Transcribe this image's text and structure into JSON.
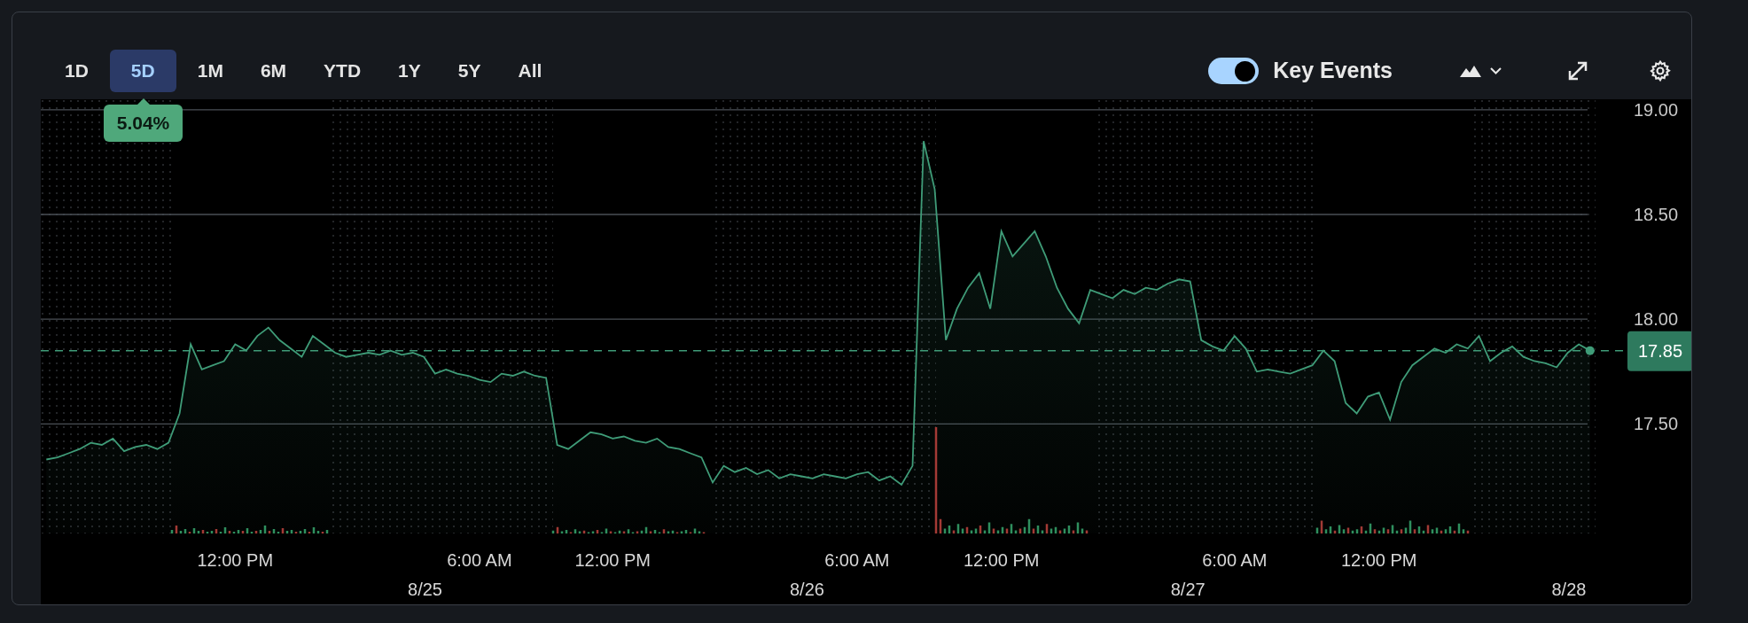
{
  "range_tabs": [
    {
      "label": "1D",
      "selected": false
    },
    {
      "label": "5D",
      "selected": true
    },
    {
      "label": "1M",
      "selected": false
    },
    {
      "label": "6M",
      "selected": false
    },
    {
      "label": "YTD",
      "selected": false
    },
    {
      "label": "1Y",
      "selected": false
    },
    {
      "label": "5Y",
      "selected": false
    },
    {
      "label": "All",
      "selected": false
    }
  ],
  "change_badge": "5.04%",
  "key_events": {
    "label": "Key Events",
    "on": true
  },
  "chart": {
    "current_price": "17.85",
    "date_labels": [
      "8/25",
      "8/26",
      "8/27",
      "8/28"
    ],
    "chart_data": {
      "type": "area",
      "grid": true,
      "categories": [
        null,
        null,
        null,
        null,
        null,
        null,
        null,
        null,
        null,
        null,
        null,
        null,
        null,
        null,
        null,
        null,
        null,
        "12:00 PM",
        null,
        null,
        null,
        null,
        null,
        null,
        null,
        null,
        null,
        null,
        null,
        null,
        null,
        null,
        null,
        null,
        null,
        null,
        null,
        null,
        null,
        "6:00 AM",
        null,
        null,
        null,
        null,
        null,
        null,
        null,
        null,
        null,
        null,
        null,
        "12:00 PM",
        null,
        null,
        null,
        null,
        null,
        null,
        null,
        null,
        null,
        null,
        null,
        null,
        null,
        null,
        null,
        null,
        null,
        null,
        null,
        null,
        null,
        "6:00 AM",
        null,
        null,
        null,
        null,
        null,
        null,
        null,
        null,
        null,
        null,
        null,
        null,
        "12:00 PM",
        null,
        null,
        null,
        null,
        null,
        null,
        null,
        null,
        null,
        null,
        null,
        null,
        null,
        null,
        null,
        null,
        null,
        null,
        null,
        null,
        "6:00 AM",
        null,
        null,
        null,
        null,
        null,
        null,
        null,
        null,
        null,
        null,
        null,
        null,
        "12:00 PM",
        null,
        null,
        null,
        null,
        null,
        null,
        null,
        null,
        null,
        null,
        null,
        null,
        null,
        null,
        null,
        null,
        null,
        null,
        null
      ],
      "ylim": [
        16.63,
        19.05
      ],
      "ref_lines": [
        {
          "value": 17.85,
          "axis": "y"
        }
      ],
      "yticks": [
        {
          "value": 17.5,
          "label": "17.50"
        },
        {
          "value": 18,
          "label": "18.00"
        },
        {
          "value": 18.5,
          "label": "18.50"
        },
        {
          "value": 19,
          "label": "19.00"
        }
      ],
      "series": [
        {
          "color": "#3f9c78",
          "values": [
            17.33,
            17.34,
            17.36,
            17.38,
            17.41,
            17.4,
            17.43,
            17.37,
            17.39,
            17.4,
            17.38,
            17.41,
            17.55,
            17.88,
            17.76,
            17.78,
            17.8,
            17.88,
            17.85,
            17.92,
            17.96,
            17.9,
            17.86,
            17.82,
            17.92,
            17.88,
            17.84,
            17.82,
            17.83,
            17.84,
            17.83,
            17.85,
            17.83,
            17.84,
            17.82,
            17.74,
            17.76,
            17.74,
            17.73,
            17.71,
            17.7,
            17.74,
            17.73,
            17.75,
            17.73,
            17.72,
            17.4,
            17.38,
            17.42,
            17.46,
            17.45,
            17.43,
            17.44,
            17.42,
            17.41,
            17.43,
            17.39,
            17.38,
            17.36,
            17.34,
            17.22,
            17.3,
            17.27,
            17.29,
            17.26,
            17.28,
            17.24,
            17.26,
            17.25,
            17.24,
            17.26,
            17.25,
            17.24,
            17.26,
            17.27,
            17.23,
            17.25,
            17.21,
            17.3,
            18.85,
            18.62,
            17.9,
            18.05,
            18.15,
            18.22,
            18.05,
            18.42,
            18.3,
            18.36,
            18.42,
            18.3,
            18.15,
            18.05,
            17.98,
            18.14,
            18.12,
            18.1,
            18.14,
            18.12,
            18.15,
            18.14,
            18.17,
            18.19,
            18.18,
            17.9,
            17.87,
            17.85,
            17.92,
            17.86,
            17.75,
            17.76,
            17.75,
            17.74,
            17.76,
            17.78,
            17.85,
            17.8,
            17.6,
            17.55,
            17.63,
            17.65,
            17.52,
            17.7,
            17.78,
            17.82,
            17.86,
            17.84,
            17.88,
            17.86,
            17.92,
            17.8,
            17.84,
            17.87,
            17.82,
            17.8,
            17.79,
            17.77,
            17.84,
            17.88,
            17.85
          ]
        }
      ]
    }
  }
}
